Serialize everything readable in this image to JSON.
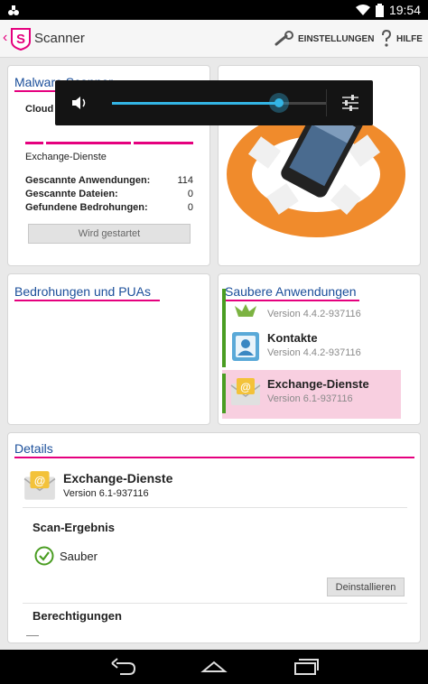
{
  "status_bar": {
    "time": "19:54"
  },
  "action_bar": {
    "title": "Scanner",
    "settings_label": "EINSTELLUNGEN",
    "help_label": "HILFE"
  },
  "malware_card": {
    "title": "Malware Scanner",
    "cloud_label": "Cloud S",
    "current_item": "Exchange-Dienste",
    "stats": [
      {
        "label": "Gescannte Anwendungen:",
        "value": "114"
      },
      {
        "label": "Gescannte Dateien:",
        "value": "0"
      },
      {
        "label": "Gefundene Bedrohungen:",
        "value": "0"
      }
    ],
    "status_button": "Wird gestartet"
  },
  "threats_card": {
    "title": "Bedrohungen und PUAs"
  },
  "clean_card": {
    "title": "Saubere Anwendungen",
    "apps": [
      {
        "name": "",
        "version": "Version 4.4.2-937116",
        "icon": "android-icon"
      },
      {
        "name": "Kontakte",
        "version": "Version 4.4.2-937116",
        "icon": "contacts-icon"
      },
      {
        "name": "Exchange-Dienste",
        "version": "Version 6.1-937116",
        "icon": "exchange-mail-icon",
        "selected": true
      }
    ]
  },
  "details": {
    "title": "Details",
    "app_name": "Exchange-Dienste",
    "app_version": "Version 6.1-937116",
    "scan_result_heading": "Scan-Ergebnis",
    "scan_result": "Sauber",
    "uninstall_button": "Deinstallieren",
    "permissions_heading": "Berechtigungen"
  },
  "volume_overlay": {
    "level": 0.78
  },
  "colors": {
    "accent": "#e5007e",
    "title_blue": "#1a4e9a",
    "clean_green": "#4a9d22",
    "selected_bg": "#f8cfe0",
    "volume_blue": "#33b5e5"
  }
}
